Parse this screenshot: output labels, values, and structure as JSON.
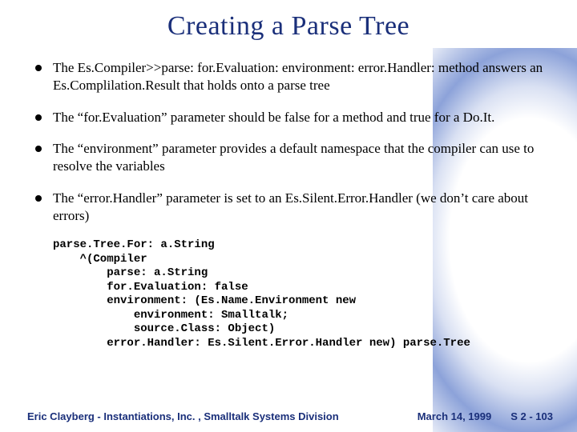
{
  "title": "Creating a Parse Tree",
  "bullets": [
    "The Es.Compiler>>parse: for.Evaluation: environment: error.Handler: method answers an Es.Complilation.Result that holds onto a parse tree",
    "The “for.Evaluation” parameter should be false for a method and true for a Do.It.",
    "The “environment” parameter provides a default namespace that the compiler can use to resolve the variables",
    "The “error.Handler” parameter is set to an Es.Silent.Error.Handler (we don’t care about errors)"
  ],
  "code": "parse.Tree.For: a.String\n    ^(Compiler\n        parse: a.String\n        for.Evaluation: false\n        environment: (Es.Name.Environment new\n            environment: Smalltalk;\n            source.Class: Object)\n        error.Handler: Es.Silent.Error.Handler new) parse.Tree",
  "footer": {
    "org": "Eric Clayberg - Instantiations, Inc. , Smalltalk Systems Division",
    "date": "March 14, 1999",
    "page": "S 2 - 103"
  }
}
